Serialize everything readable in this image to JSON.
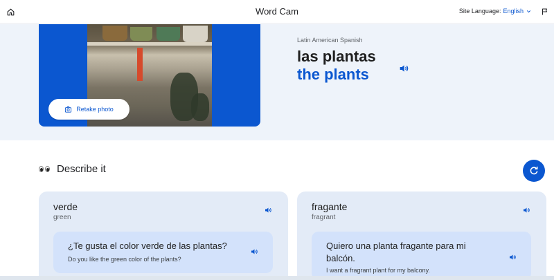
{
  "header": {
    "title": "Word Cam",
    "site_language_label": "Site Language:",
    "site_language_value": "English",
    "icons": {
      "home": "home-icon",
      "flag": "flag-icon",
      "dropdown": "chevron-down-icon"
    }
  },
  "hero": {
    "retake_label": "Retake photo",
    "dialect": "Latin American Spanish",
    "word_es": "las plantas",
    "word_en": "the plants"
  },
  "describe": {
    "title": "Describe it"
  },
  "cards": [
    {
      "word": "verde",
      "translation": "green",
      "example": "¿Te gusta el color verde de las plantas?",
      "example_translation": "Do you like the green color of the plants?"
    },
    {
      "word": "fragante",
      "translation": "fragrant",
      "example": "Quiero una planta fragante para mi balcón.",
      "example_translation": "I want a fragrant plant for my balcony."
    }
  ],
  "colors": {
    "accent": "#0b57d0",
    "hero_bg": "#eef3fa",
    "card_bg": "#e3ebf7",
    "example_bg": "#d3e2fb"
  }
}
